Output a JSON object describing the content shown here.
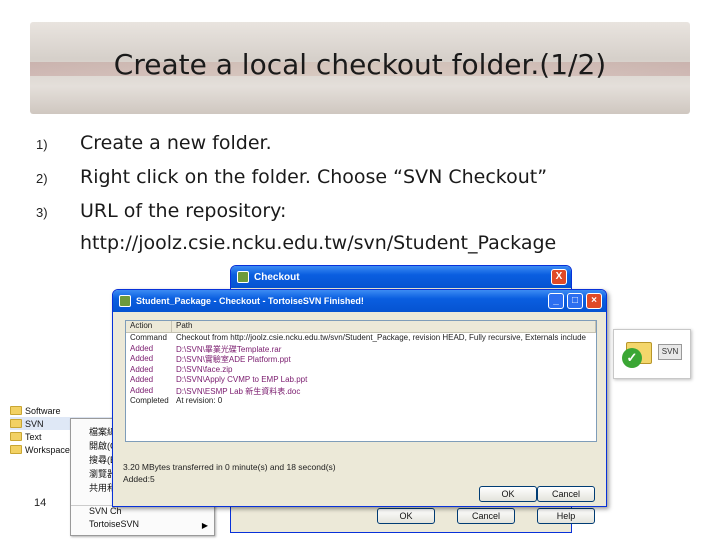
{
  "slide": {
    "title": "Create a local checkout folder.(1/2)",
    "steps": [
      {
        "num": "1)",
        "text": "Create a new folder."
      },
      {
        "num": "2)",
        "text": "Right click on the folder. Choose “SVN Checkout”"
      },
      {
        "num": "3)",
        "text": "URL of the repository:"
      }
    ],
    "url": "http://joolz.csie.ncku.edu.tw/svn/Student_Package",
    "page_number": "14"
  },
  "explorer": {
    "items": [
      {
        "label": "Software",
        "selected": false
      },
      {
        "label": "SVN",
        "selected": true
      },
      {
        "label": "Text",
        "selected": false
      },
      {
        "label": "Workspace-",
        "selected": false
      }
    ]
  },
  "context_menu": {
    "items": [
      "檔案總",
      "開啟(O",
      "搜尋(E",
      "瀏覽器",
      "共用和"
    ],
    "svn_checkout": "SVN Ch",
    "tortoise": "TortoiseSVN"
  },
  "checkout_dialog": {
    "title": "Checkout",
    "close": "X",
    "buttons": {
      "ok": "OK",
      "cancel": "Cancel",
      "help": "Help"
    }
  },
  "finished_dialog": {
    "title": "Student_Package - Checkout - TortoiseSVN Finished!",
    "columns": {
      "action": "Action",
      "path": "Path"
    },
    "rows": [
      {
        "action": "Command",
        "path": "Checkout from http://joolz.csie.ncku.edu.tw/svn/Student_Package, revision HEAD, Fully recursive, Externals include",
        "kind": "cmd"
      },
      {
        "action": "Added",
        "path": "D:\\SVN\\畢業光碟Template.rar",
        "kind": "added"
      },
      {
        "action": "Added",
        "path": "D:\\SVN\\實驗室ADE Platform.ppt",
        "kind": "added"
      },
      {
        "action": "Added",
        "path": "D:\\SVN\\face.zip",
        "kind": "added"
      },
      {
        "action": "Added",
        "path": "D:\\SVN\\Apply CVMP to EMP Lab.ppt",
        "kind": "added"
      },
      {
        "action": "Added",
        "path": "D:\\SVN\\ESMP Lab 新生資料表.doc",
        "kind": "added"
      },
      {
        "action": "Completed",
        "path": "At revision: 0",
        "kind": "done"
      }
    ],
    "transfer": "3.20 MBytes transferred in 0 minute(s) and 18 second(s)",
    "added_count": "Added:5",
    "buttons": {
      "ok": "OK",
      "cancel": "Cancel"
    }
  },
  "svn_badge": {
    "label": "SVN"
  }
}
